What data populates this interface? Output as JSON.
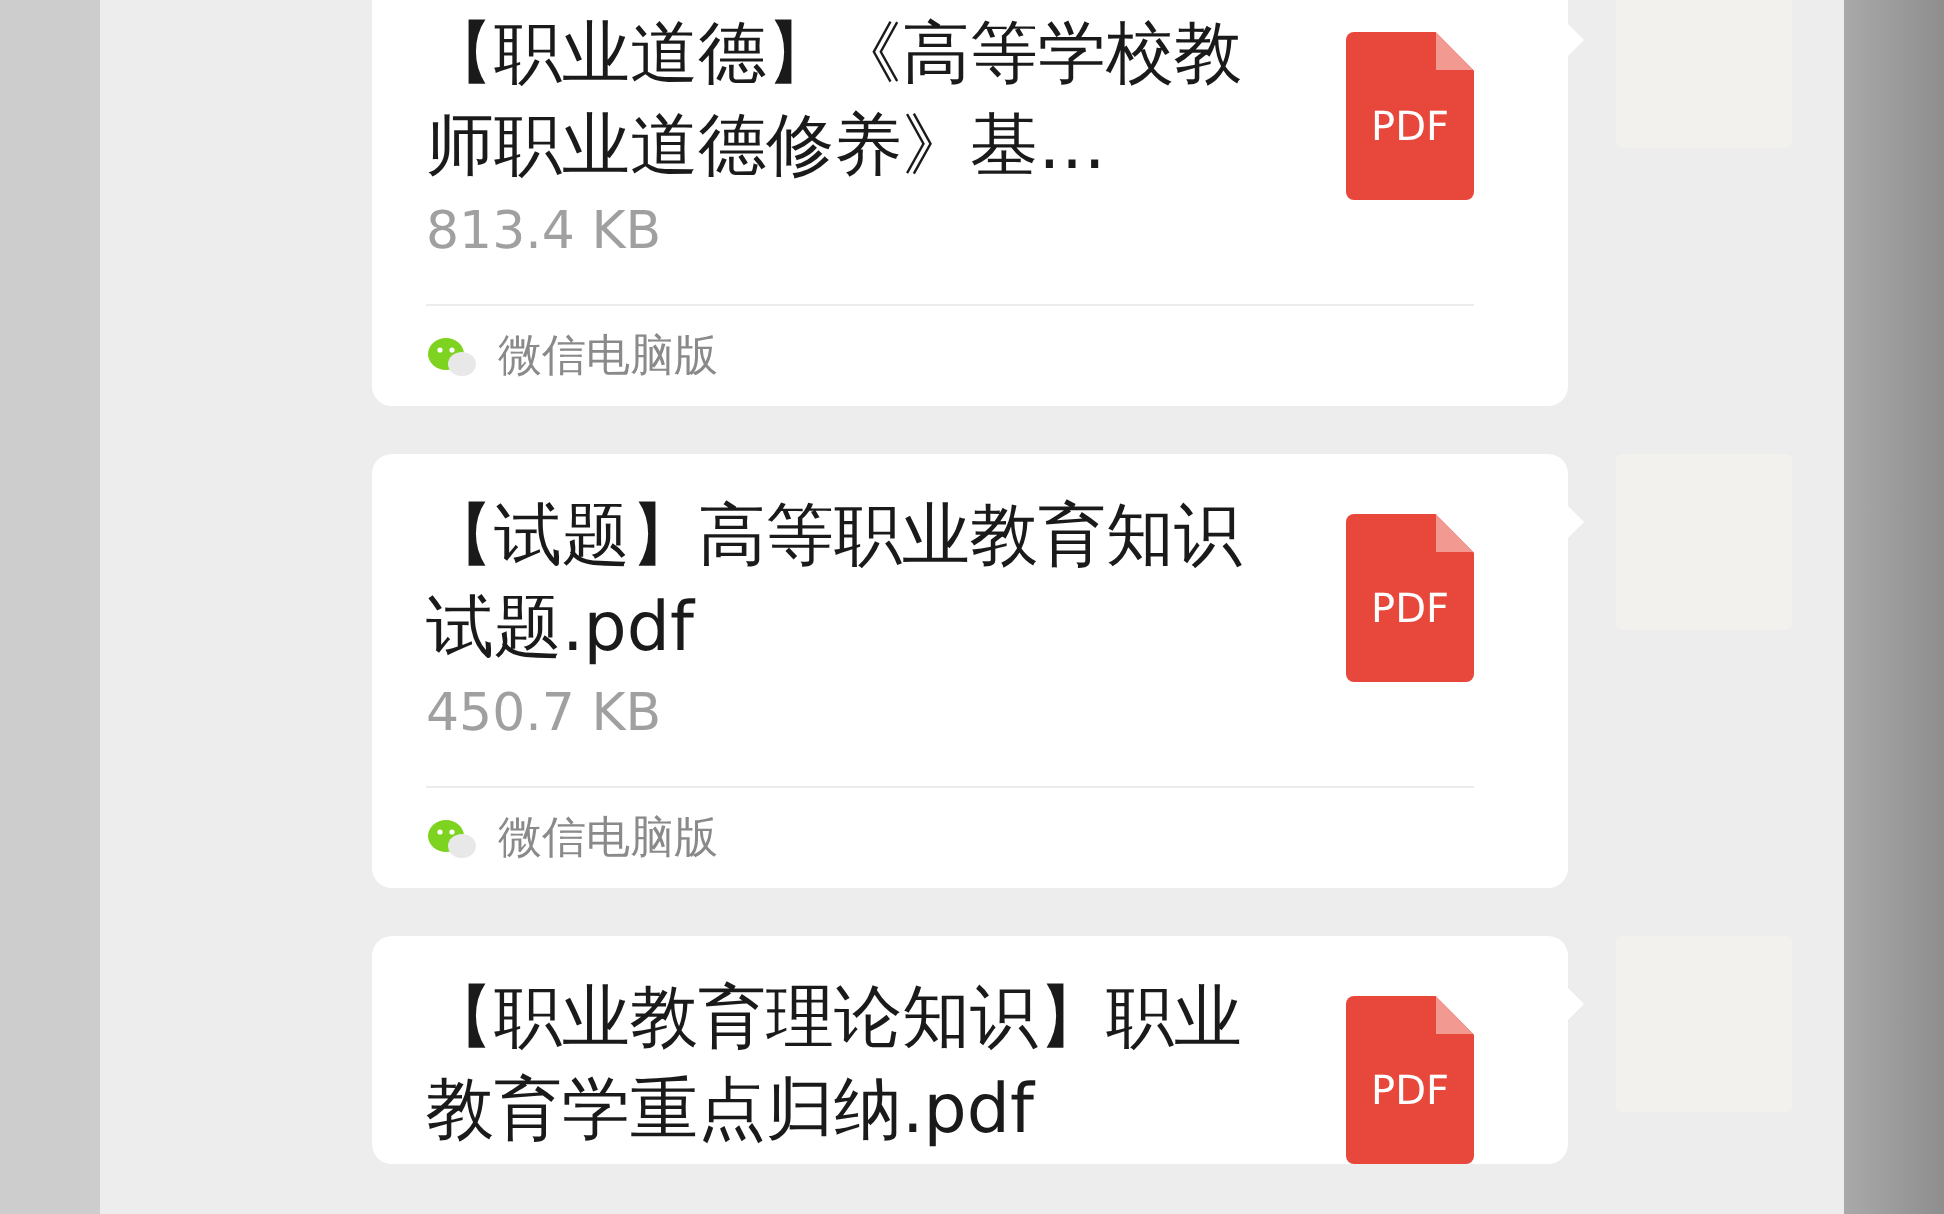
{
  "messages": [
    {
      "title": "【职业道德】《高等学校教师职业道德修养》基…",
      "file_type": "PDF",
      "size": "813.4 KB",
      "source": "微信电脑版"
    },
    {
      "title": "【试题】高等职业教育知识试题.pdf",
      "file_type": "PDF",
      "size": "450.7 KB",
      "source": "微信电脑版"
    },
    {
      "title": "【职业教育理论知识】职业教育学重点归纳.pdf",
      "file_type": "PDF"
    }
  ]
}
